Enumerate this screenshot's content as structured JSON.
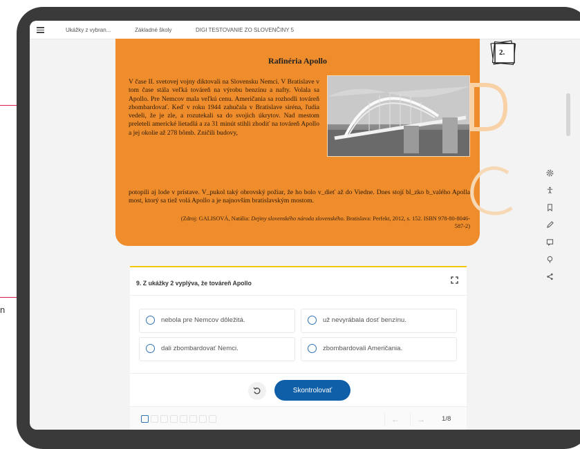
{
  "breadcrumbs": [
    "Ukážky z vybran...",
    "Základné školy",
    "DIGI TESTOVANIE ZO SLOVENČINY 5"
  ],
  "article": {
    "title": "Rafinéria Apollo",
    "paragraph_wrapped": "V čase II. svetovej vojny diktovali na Slovensku Nemci. V Bratislave v tom čase stála veľká továreň na výrobu benzínu a nafty. Volala sa Apollo. Pre Nemcov mala veľkú cenu. Američania sa rozhodli továreň zbombardovať. Keď v roku 1944 zahučala v Bratislave siréna, ľudia vedeli, že je zle, a rozutekali sa do svojich úkrytov. Nad mestom preleteli americké lietadlá a za 31 minút stihli zhodiť na továreň Apollo a jej okolie až 278 bômb. Zničili budovy,",
    "paragraph_full": "potopili aj lode v prístave. V_pukol taký obrovský požiar, že ho bolo v_dieť až do Viedne. Dnes stojí bl_zko b_valého Apolla most, ktorý sa tiež volá Apollo a je najnovším bratislavským mostom.",
    "source_prefix": "(Zdroj: GALISOVÁ, Natália:",
    "source_title": "Dejiny slovenského národa slovenského",
    "source_suffix": ". Bratislava: Perfekt, 2012, s. 152. ISBN 978-80-8046-587-2)"
  },
  "badge": {
    "number": "2."
  },
  "deco_letters": [
    "D",
    "C"
  ],
  "question": {
    "title": "9. Z ukážky 2 vyplýva, že továreň Apollo",
    "options": [
      "nebola pre Nemcov dôležitá.",
      "už nevyrábala dosť benzínu.",
      "dali zbombardovať Nemci.",
      "zbombardovali Američania."
    ],
    "check_label": "Skontrolovať",
    "counter": "1/8",
    "progress_total": 8
  },
  "side_label_fragment": "n",
  "tools": [
    "gear-icon",
    "accessibility-icon",
    "bookmark-icon",
    "pencil-icon",
    "note-icon",
    "pin-icon",
    "share-icon"
  ],
  "colors": {
    "orange": "#ef8c2b",
    "accent_blue": "#0f5fa8",
    "annotation_red": "#d81b47",
    "question_border": "#f2c700"
  }
}
